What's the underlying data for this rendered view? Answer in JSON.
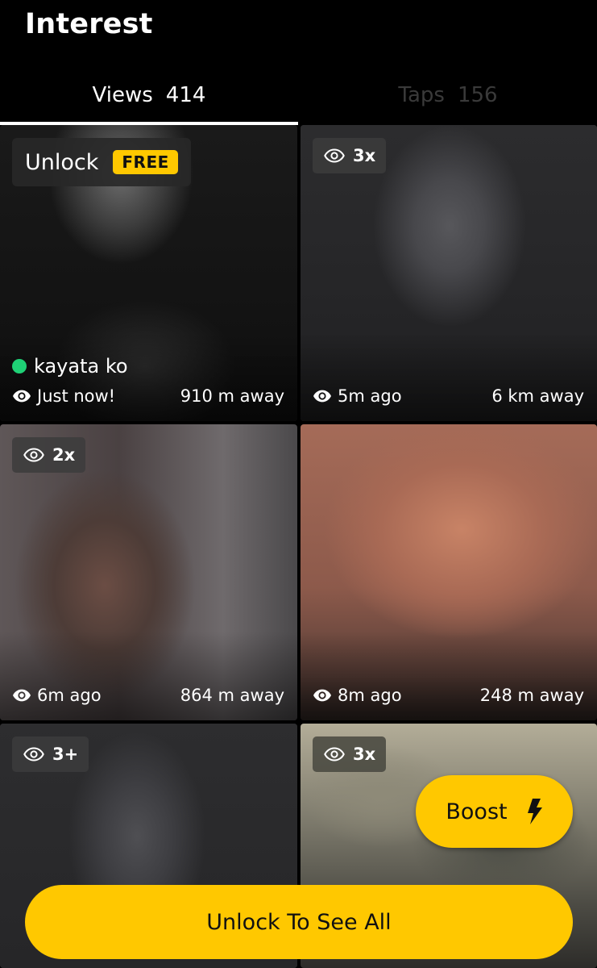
{
  "header": {
    "title": "Interest"
  },
  "tabs": [
    {
      "label": "Views",
      "count": "414",
      "active": true
    },
    {
      "label": "Taps",
      "count": "156",
      "active": false
    }
  ],
  "cards": [
    {
      "unlock_label": "Unlock",
      "free_label": "FREE",
      "name": "kayata ko",
      "online": true,
      "time": "Just now!",
      "distance": "910 m away"
    },
    {
      "views": "3x",
      "time": "5m ago",
      "distance": "6 km away"
    },
    {
      "views": "2x",
      "time": "6m ago",
      "distance": "864 m away"
    },
    {
      "views": "",
      "time": "8m ago",
      "distance": "248 m away"
    },
    {
      "views": "3+"
    },
    {
      "views": "3x"
    }
  ],
  "boost": {
    "label": "Boost",
    "icon": "lightning-bolt-icon"
  },
  "unlock_all": {
    "label": "Unlock To See All"
  },
  "colors": {
    "accent": "#ffc800",
    "online": "#1fd176",
    "background": "#000000",
    "inactive_tab": "#3a3a3a"
  }
}
